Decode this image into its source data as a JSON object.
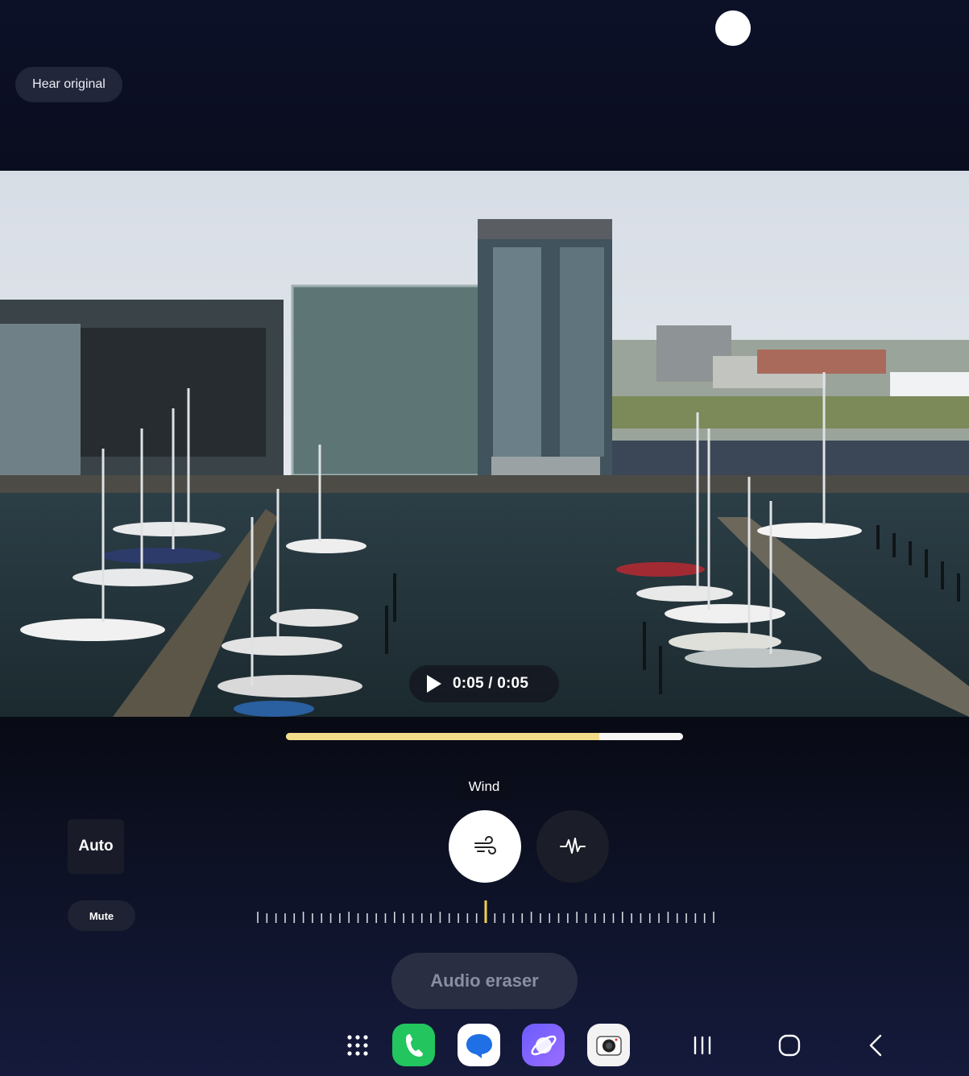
{
  "top": {
    "hear_original_label": "Hear original"
  },
  "player": {
    "time": "0:05 / 0:05",
    "progress": 0.79
  },
  "audio": {
    "tooltip_label": "Wind",
    "auto_label": "Auto",
    "mute_label": "Mute",
    "wind_icon": "wind-icon",
    "voice_icon": "voice-waveform-icon",
    "slider_position": 0.5,
    "eraser_label": "Audio eraser"
  },
  "colors": {
    "progress_fill": "#f2dc8a",
    "slider_marker": "#f2d04a",
    "phone_green": "#22c55e",
    "messages_blue": "#1f6fe5",
    "internet_purple": "#7b61ff"
  },
  "dock": {
    "apps": [
      "apps-grid-icon",
      "phone-icon",
      "messages-icon",
      "internet-icon",
      "camera-icon"
    ]
  },
  "nav": {
    "buttons": [
      "recent-apps-icon",
      "home-icon",
      "back-icon"
    ]
  }
}
